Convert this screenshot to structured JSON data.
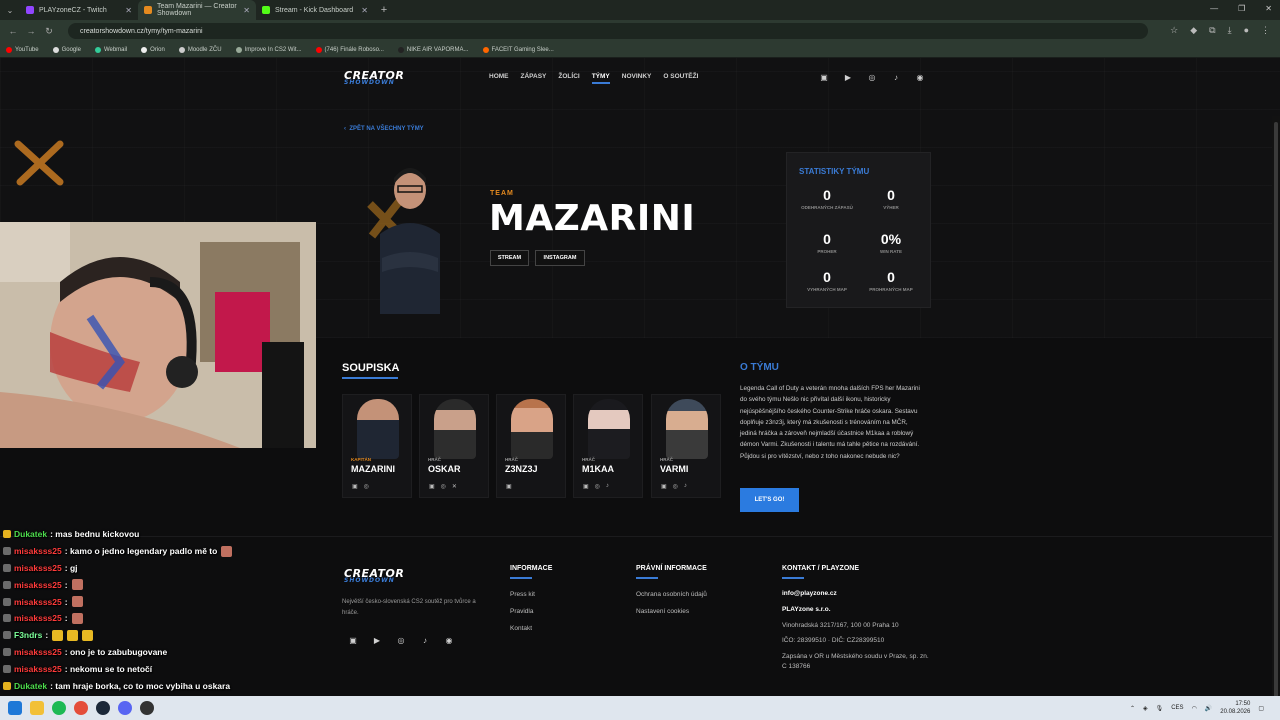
{
  "browser": {
    "tabs": [
      {
        "title": "PLAYzoneCZ - Twitch",
        "color": "#9146ff"
      },
      {
        "title": "Team Mazarini — Creator Showdown",
        "color": "#e58a1f"
      },
      {
        "title": "Stream - Kick Dashboard",
        "color": "#53fc18"
      }
    ],
    "url": "creatorshowdown.cz/tymy/tym-mazarini",
    "bookmarks": [
      "YouTube",
      "Google",
      "Webmail",
      "Orion",
      "Moodle ZČU",
      "Improve In CS2 Wit...",
      "(746) Finále Roboso...",
      "NIKE AIR VAPORMA...",
      "FACEIT Gaming Slee..."
    ]
  },
  "site": {
    "logo": "CREATOR",
    "logo_sub": "SHOWDOWN",
    "nav": [
      "HOME",
      "ZÁPASY",
      "ŽOLÍCI",
      "TÝMY",
      "NOVINKY",
      "O SOUTĚŽI"
    ],
    "active_nav": "TÝMY",
    "back_link": "ZPĚT NA VŠECHNY TÝMY"
  },
  "team": {
    "label": "TEAM",
    "name": "MAZARINI",
    "buttons": [
      "STREAM",
      "INSTAGRAM"
    ]
  },
  "stats": {
    "title": "STATISTIKY TÝMU",
    "items": [
      {
        "value": "0",
        "label": "ODEHRANÝCH ZÁPASŮ"
      },
      {
        "value": "0",
        "label": "VÝHER"
      },
      {
        "value": "0",
        "label": "PROHER"
      },
      {
        "value": "0%",
        "label": "WIN RATE"
      },
      {
        "value": "0",
        "label": "VYHRANÝCH MAP"
      },
      {
        "value": "0",
        "label": "PROHRANÝCH MAP"
      }
    ]
  },
  "roster": {
    "title": "SOUPISKA",
    "players": [
      {
        "role": "KAPITÁN",
        "name": "MAZARINI",
        "icons": [
          "twitch-icon",
          "instagram-icon"
        ],
        "tone": "#2b3340"
      },
      {
        "role": "HRÁČ",
        "name": "OSKAR",
        "icons": [
          "twitch-icon",
          "instagram-icon",
          "x-icon"
        ],
        "tone": "#6e5a4d"
      },
      {
        "role": "HRÁČ",
        "name": "Z3NZ3J",
        "icons": [
          "twitch-icon"
        ],
        "tone": "#8a5f4a"
      },
      {
        "role": "HRÁČ",
        "name": "M1KAA",
        "icons": [
          "twitch-icon",
          "instagram-icon",
          "tiktok-icon"
        ],
        "tone": "#3b3540"
      },
      {
        "role": "HRÁČ",
        "name": "VARMI",
        "icons": [
          "twitch-icon",
          "instagram-icon",
          "tiktok-icon"
        ],
        "tone": "#7a6b60"
      }
    ]
  },
  "about": {
    "title": "O TÝMU",
    "text": "Legenda Call of Duty a veterán mnoha dalších FPS her Mazarini do svého týmu Nešlo nic přivítal další ikonu, historicky nejúspěšnějšího českého Counter-Strike hráče oskara. Sestavu doplňuje z3nz3j, který má zkušenosti s trénováním na MČR, jediná hráčka a zároveň nejmladší účastnice M1kaa a roblowý démon Varmi. Zkušenosti i talentu má tahle pětice na rozdávání. Půjdou si pro vítězství, nebo z toho nakonec nebude nic?",
    "cta": "LET'S GO!"
  },
  "footer": {
    "desc": "Největší česko-slovenská CS2 soutěž pro tvůrce a hráče.",
    "informace_title": "INFORMACE",
    "informace_links": [
      "Press kit",
      "Pravidla",
      "Kontakt"
    ],
    "pravni_title": "PRÁVNÍ INFORMACE",
    "pravni_links": [
      "Ochrana osobních údajů",
      "Nastavení cookies"
    ],
    "kontakt_title": "KONTAKT / PLAYZONE",
    "kontakt_email": "info@playzone.cz",
    "kontakt_company": "PLAYzone s.r.o.",
    "kontakt_address": "Vinohradská 3217/167, 100 00 Praha 10",
    "kontakt_ico": "IČO: 28399510 · DIČ: CZ28399510",
    "kontakt_reg": "Zapsána v OR u Městského soudu v Praze, sp. zn. C 138766"
  },
  "chat": [
    {
      "user": "Dukatek",
      "color": "#4ddc4d",
      "msg": "mas bednu kickovou",
      "emotes": 0
    },
    {
      "user": "misaksss25",
      "color": "#ff3b3b",
      "msg": "kamo o jedno legendary padlo mě to",
      "emotes": 1
    },
    {
      "user": "misaksss25",
      "color": "#ff3b3b",
      "msg": "gj",
      "emotes": 0
    },
    {
      "user": "misaksss25",
      "color": "#ff3b3b",
      "msg": "",
      "emotes": 1
    },
    {
      "user": "misaksss25",
      "color": "#ff3b3b",
      "msg": "",
      "emotes": 1
    },
    {
      "user": "misaksss25",
      "color": "#ff3b3b",
      "msg": "",
      "emotes": 1
    },
    {
      "user": "F3ndrs",
      "color": "#7cff9a",
      "msg": "",
      "emotes": 3
    },
    {
      "user": "misaksss25",
      "color": "#ff3b3b",
      "msg": "ono je to zabubugovane",
      "emotes": 0
    },
    {
      "user": "misaksss25",
      "color": "#ff3b3b",
      "msg": "nekomu se to netočí",
      "emotes": 0
    },
    {
      "user": "Dukatek",
      "color": "#4ddc4d",
      "msg": "tam hraje borka, co to moc vybiha u oskara",
      "emotes": 0
    }
  ],
  "taskbar": {
    "lang": "CES",
    "time": "17:50",
    "date": "20.08.2026"
  }
}
